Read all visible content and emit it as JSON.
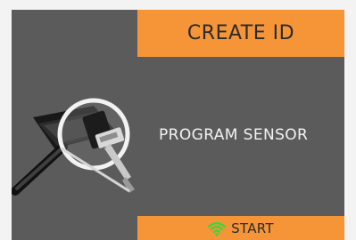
{
  "header": {
    "title": "CREATE ID"
  },
  "main": {
    "label": "PROGRAM SENSOR",
    "illustration_icon": "tpms-sensor-magnifier-icon"
  },
  "start_button": {
    "label": "START",
    "icon": "wifi-signal-icon"
  },
  "colors": {
    "accent": "#f59537",
    "screen_background": "#5b5b5b",
    "page_background": "#f3f3f3",
    "signal_green": "#43d33b"
  }
}
